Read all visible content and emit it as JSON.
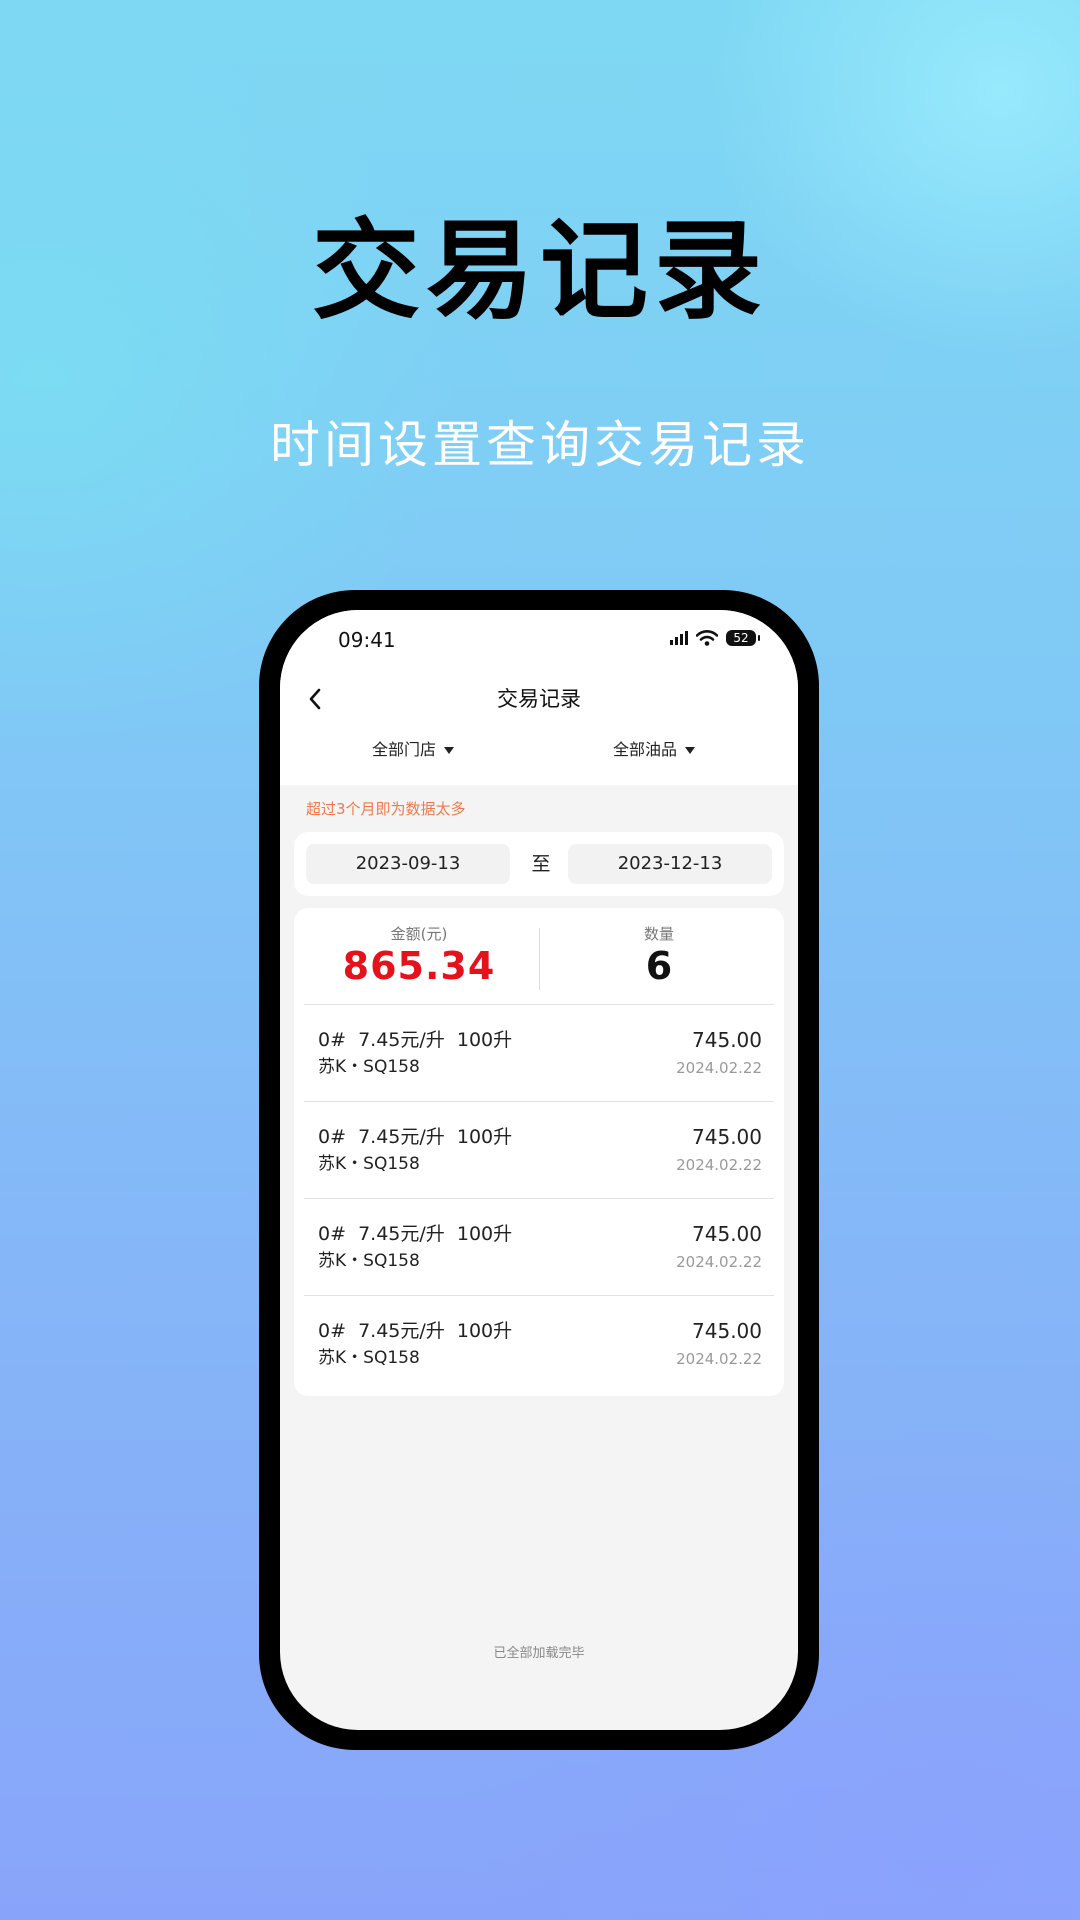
{
  "promo": {
    "headline": "交易记录",
    "subheadline": "时间设置查询交易记录"
  },
  "status_bar": {
    "time": "09:41",
    "battery": "52",
    "icons": [
      "signal-icon",
      "wifi-icon",
      "battery-icon"
    ]
  },
  "nav": {
    "title": "交易记录",
    "back_icon": "chevron-left-icon"
  },
  "filters": {
    "store": "全部门店",
    "product": "全部油品"
  },
  "notice": "超过3个月即为数据太多",
  "date_range": {
    "start": "2023-09-13",
    "separator": "至",
    "end": "2023-12-13"
  },
  "summary": {
    "amount_label": "金额(元)",
    "amount_value": "865.34",
    "count_label": "数量",
    "count_value": "6"
  },
  "transactions": [
    {
      "desc": "0#  7.45元/升  100升",
      "plate": "苏K・SQ158",
      "amount": "745.00",
      "date": "2024.02.22"
    },
    {
      "desc": "0#  7.45元/升  100升",
      "plate": "苏K・SQ158",
      "amount": "745.00",
      "date": "2024.02.22"
    },
    {
      "desc": "0#  7.45元/升  100升",
      "plate": "苏K・SQ158",
      "amount": "745.00",
      "date": "2024.02.22"
    },
    {
      "desc": "0#  7.45元/升  100升",
      "plate": "苏K・SQ158",
      "amount": "745.00",
      "date": "2024.02.22"
    }
  ],
  "footer": "已全部加载完毕",
  "colors": {
    "amount": "#e3121b",
    "notice": "#f07a4a"
  }
}
